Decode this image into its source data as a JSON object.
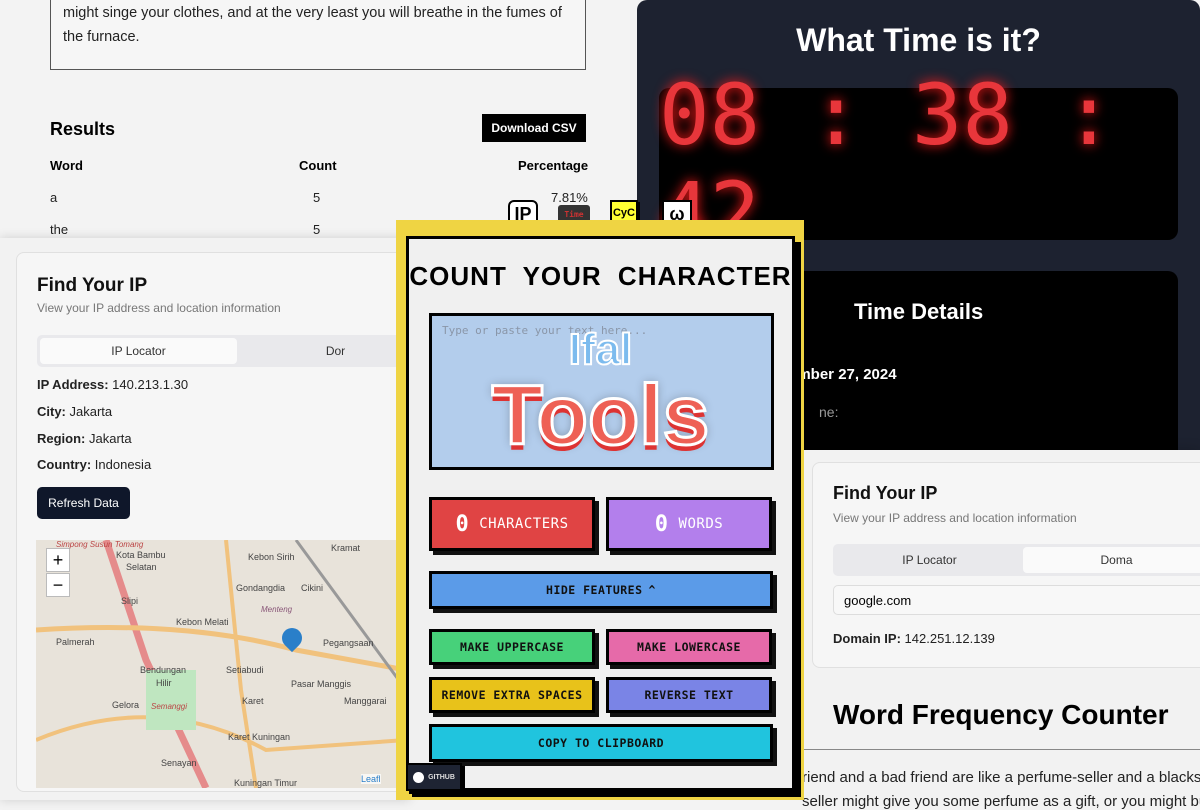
{
  "word_freq_top": {
    "text": "might singe your clothes, and at the very least you will breathe in the fumes of the furnace.",
    "results_title": "Results",
    "download_label": "Download CSV",
    "headers": [
      "Word",
      "Count",
      "Percentage"
    ],
    "rows": [
      {
        "word": "a",
        "count": "5",
        "pct": "7.81%"
      },
      {
        "word": "the",
        "count": "5",
        "pct": ""
      }
    ]
  },
  "time": {
    "title": "What Time is it?",
    "clock": "08 : 38 : 42",
    "details_title": "Time Details",
    "date": "ember 27, 2024",
    "tz_label": "ne:"
  },
  "ip_left": {
    "title": "Find Your IP",
    "subtitle": "View your IP address and location information",
    "tabs": [
      "IP Locator",
      "Dor"
    ],
    "fields": [
      {
        "label": "IP Address:",
        "value": "140.213.1.30"
      },
      {
        "label": "City:",
        "value": "Jakarta"
      },
      {
        "label": "Region:",
        "value": "Jakarta"
      },
      {
        "label": "Country:",
        "value": "Indonesia"
      }
    ],
    "refresh_label": "Refresh Data",
    "map": {
      "zoom_in": "+",
      "zoom_out": "−",
      "attribution": "Leafl",
      "places": [
        "Simpong Susun Tomang",
        "Kota Bambu",
        "Selatan",
        "Kebon Sirih",
        "Kramat",
        "Gondangdia",
        "Cikini",
        "Slipi",
        "Kebon Melati",
        "Menteng",
        "Palmerah",
        "Pegangsaan",
        "Bendungan",
        "Hilir",
        "Setiabudi",
        "Pasar Manggis",
        "Gelora",
        "Semanggi",
        "Karet",
        "Manggarai",
        "Karet Kuningan",
        "Senayan",
        "Kuningan Timur"
      ]
    }
  },
  "ip_right": {
    "title": "Find Your IP",
    "subtitle": "View your IP address and location information",
    "tabs": [
      "IP Locator",
      "Doma"
    ],
    "domain_value": "google.com",
    "domain_ip_label": "Domain IP:",
    "domain_ip": "142.251.12.139"
  },
  "wfc": {
    "title": "Word Frequency Counter",
    "text": "riend and a bad friend are like a perfume-seller and a blacksmit",
    "text2": "seller might give you some perfume as a gift, or you might bu"
  },
  "cyc": {
    "title": "COUNT YOUR CHARACTER",
    "placeholder": "Type or paste your text here...",
    "logo_top": "Ifal",
    "logo_bottom": "Tools",
    "char_count": "0",
    "char_label": "CHARACTERS",
    "word_count": "0",
    "word_label": "WORDS",
    "hide_features": "HIDE FEATURES",
    "uppercase": "MAKE UPPERCASE",
    "lowercase": "MAKE LOWERCASE",
    "remove_spaces": "REMOVE EXTRA SPACES",
    "reverse": "REVERSE TEXT",
    "copy": "COPY TO CLIPBOARD",
    "github": "GITHUB"
  },
  "app_icons": {
    "ip": "IP",
    "time": "Time",
    "cyc": "CyC",
    "omega": "ω"
  },
  "colors": {
    "yellow": "#efd443",
    "red": "#e04444",
    "purple": "#b37fec",
    "blue": "#5b9be8",
    "green": "#47d17a",
    "pink": "#e66aa9",
    "gold": "#e8c21a",
    "indigo": "#7a84e6",
    "cyan": "#20c4de",
    "clock_red": "#e8363b"
  }
}
